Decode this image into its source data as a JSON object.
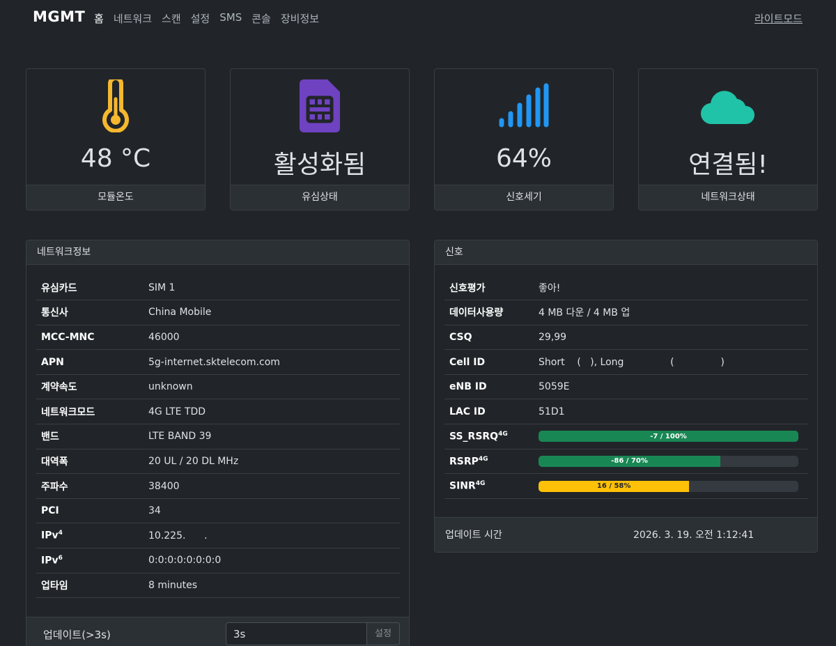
{
  "nav": {
    "brand": "MGMT",
    "items": [
      "홈",
      "네트워크",
      "스캔",
      "설정",
      "SMS",
      "콘솔",
      "장비정보"
    ],
    "mode_toggle": "라이트모드"
  },
  "stats": [
    {
      "value": "48 °C",
      "label": "모듈온도",
      "icon": "thermometer-icon",
      "color": "#f5b82e"
    },
    {
      "value": "활성화됨",
      "label": "유심상태",
      "icon": "sim-card-icon",
      "color": "#6f42c1"
    },
    {
      "value": "64%",
      "label": "신호세기",
      "icon": "signal-bars-icon",
      "color": "#2196f3"
    },
    {
      "value": "연결됨!",
      "label": "네트워크상태",
      "icon": "cloud-icon",
      "color": "#20c3a8"
    }
  ],
  "network": {
    "title": "네트워크정보",
    "rows": [
      {
        "k": "유심카드",
        "v": "SIM 1"
      },
      {
        "k": "통신사",
        "v": "China Mobile"
      },
      {
        "k": "MCC-MNC",
        "v": "46000"
      },
      {
        "k": "APN",
        "v": "5g-internet.sktelecom.com"
      },
      {
        "k": "계약속도",
        "v": "unknown"
      },
      {
        "k": "네트워크모드",
        "v": "4G LTE TDD"
      },
      {
        "k": "밴드",
        "v": "LTE BAND 39"
      },
      {
        "k": "대역폭",
        "v": "20 UL / 20 DL MHz"
      },
      {
        "k": "주파수",
        "v": "38400"
      },
      {
        "k": "PCI",
        "v": "34"
      },
      {
        "k": "IPv",
        "sup": "4",
        "v": "10.225.      ."
      },
      {
        "k": "IPv",
        "sup": "6",
        "v": "0:0:0:0:0:0:0:0"
      },
      {
        "k": "업타임",
        "v": "8 minutes"
      }
    ],
    "update_label": "업데이트(>3s)",
    "update_value": "3s",
    "update_button": "설정"
  },
  "signal": {
    "title": "신호",
    "rows": [
      {
        "k": "신호평가",
        "v": "좋아!"
      },
      {
        "k": "데이터사용량",
        "v": "4 MB 다운 / 4 MB 업"
      },
      {
        "k": "CSQ",
        "v": "29,99"
      },
      {
        "k": "Cell ID",
        "v": "Short    (   ), Long               (               )"
      },
      {
        "k": "eNB ID",
        "v": "5059E"
      },
      {
        "k": "LAC ID",
        "v": "51D1"
      }
    ],
    "bars": [
      {
        "k": "SS_RSRQ",
        "sup": "4G",
        "label": "-7 / 100%",
        "percent": 100,
        "color": "#198754"
      },
      {
        "k": "RSRP",
        "sup": "4G",
        "label": "-86 / 70%",
        "percent": 70,
        "color": "#198754"
      },
      {
        "k": "SINR",
        "sup": "4G",
        "label": "16 / 58%",
        "percent": 58,
        "color": "#ffc107"
      }
    ],
    "update_time_label": "업데이트 시간",
    "update_time_value": "2026. 3. 19. 오전 1:12:41"
  }
}
